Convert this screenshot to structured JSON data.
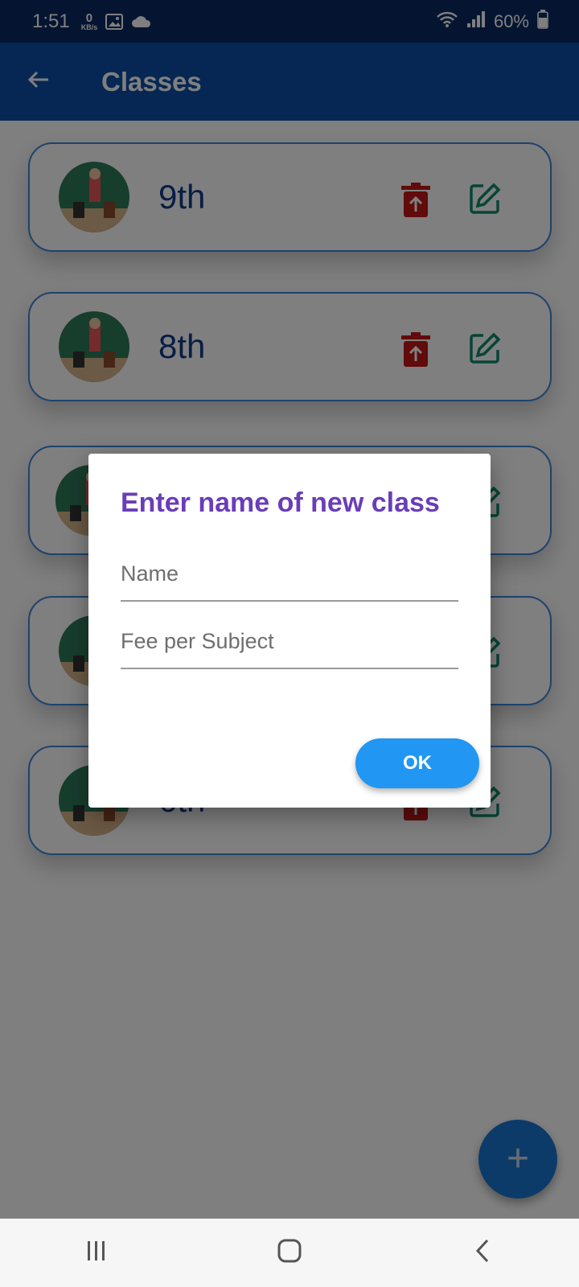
{
  "status_bar": {
    "time": "1:51",
    "speed_value": "0",
    "speed_unit": "KB/s",
    "battery": "60%",
    "icons": [
      "gallery-icon",
      "cloud-icon",
      "wifi-icon",
      "signal-icon",
      "battery-icon"
    ]
  },
  "app_bar": {
    "back_icon": "arrow-left-icon",
    "title": "Classes"
  },
  "classes": [
    {
      "name": "9th"
    },
    {
      "name": "8th"
    },
    {
      "name": ""
    },
    {
      "name": ""
    },
    {
      "name": "6th"
    }
  ],
  "card_actions": {
    "delete_icon": "trash-icon",
    "edit_icon": "edit-icon"
  },
  "dialog": {
    "title": "Enter name of new class",
    "name_label": "Name",
    "fee_label": "Fee per Subject",
    "ok_label": "OK"
  },
  "fab": {
    "icon": "plus-icon",
    "label": "+"
  },
  "nav": {
    "items": [
      "recent-apps-icon",
      "home-icon",
      "back-icon"
    ]
  },
  "colors": {
    "app_bar": "#0d4fa8",
    "status_bar": "#0b2b63",
    "dialog_title": "#6a3db8",
    "ok_button": "#2196f3",
    "delete": "#c31616",
    "edit": "#0f8a6c",
    "card_border": "#3b86d8",
    "class_name": "#103a8a",
    "fab": "#1976d2"
  }
}
